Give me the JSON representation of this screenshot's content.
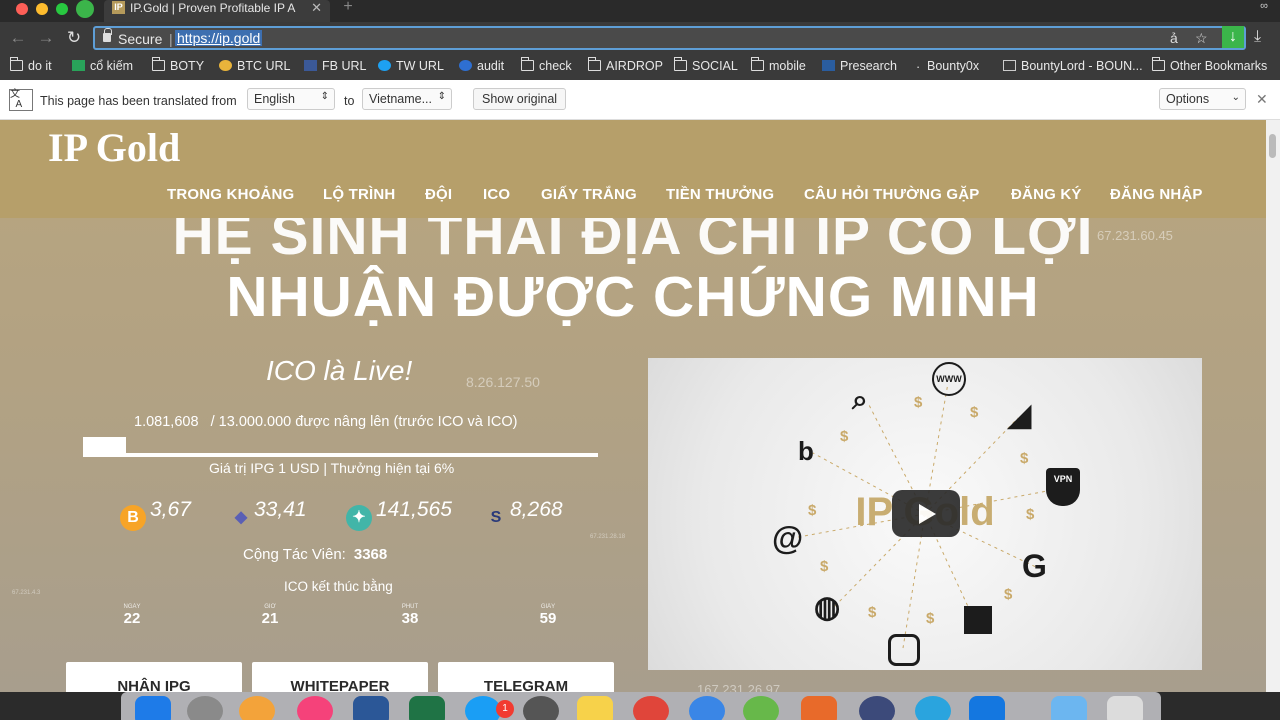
{
  "browser": {
    "tab_title": "IP.Gold | Proven Profitable IP A",
    "tab_favicon": "IP",
    "secure_label": "Secure",
    "separator": "|",
    "url": "https://ip.gold",
    "bookmarks": [
      "do it",
      "cổ kiếm",
      "BOTY",
      "BTC URL",
      "FB URL",
      "TW URL",
      "audit",
      "check",
      "AIRDROP",
      "SOCIAL",
      "mobile",
      "Presearch",
      "Bounty0x",
      "BountyLord - BOUN...",
      "Other Bookmarks"
    ]
  },
  "translate_bar": {
    "message": "This page has been translated from",
    "from_language": "English",
    "to_word": "to",
    "to_language": "Vietname...",
    "show_original": "Show original",
    "options": "Options"
  },
  "site": {
    "logo": "IP Gold",
    "nav": [
      "TRONG KHOẢNG",
      "LỘ TRÌNH",
      "ĐỘI",
      "ICO",
      "GIẤY TRẮNG",
      "TIỀN THƯỞNG",
      "CÂU HỎI THƯỜNG GẶP",
      "ĐĂNG KÝ",
      "ĐĂNG NHẬP"
    ],
    "hero_line1": "HỆ SINH THÁI ĐỊA CHỈ IP CÓ LỢI",
    "hero_line2": "NHUẬN ĐƯỢC CHỨNG MINH",
    "floating_ips": [
      "67.231.60.45",
      "8.26.127.50",
      "67.231.28.18",
      "67.231.4.3",
      "167.231.26.97"
    ]
  },
  "ico": {
    "status": "ICO là Live!",
    "raised": "1.081,608",
    "target_text": "/ 13.000.000 được nâng lên (trước ICO và ICO)",
    "progress_fraction": 0.0832,
    "price_note": "Giá trị IPG 1 USD | Thưởng hiện tại 6%",
    "coins": [
      {
        "icon": "bitcoin-icon",
        "value": "3,67",
        "color": "#f7a427"
      },
      {
        "icon": "ethereum-icon",
        "value": "33,41",
        "color": "#5a5fb5"
      },
      {
        "icon": "nem-icon",
        "value": "141,565",
        "color": "#42b5a8"
      },
      {
        "icon": "waves-icon",
        "value": "8,268",
        "color": "#2a3a7a"
      }
    ],
    "affiliates_label": "Cộng Tác Viên:",
    "affiliates_count": "3368",
    "ends_label": "ICO kết thúc bằng",
    "countdown": [
      {
        "label": "NGÀY",
        "value": "22"
      },
      {
        "label": "GIỜ",
        "value": "21"
      },
      {
        "label": "PHÚT",
        "value": "38"
      },
      {
        "label": "GIÂY",
        "value": "59"
      }
    ],
    "buttons": [
      "NHẬN IPG",
      "WHITEPAPER",
      "TELEGRAM"
    ]
  },
  "video": {
    "title": "IP Gold",
    "icons": [
      "search-icon",
      "www-icon",
      "vpn-icon",
      "google-icon",
      "bing-icon",
      "at-icon",
      "globe-icon",
      "instagram-icon",
      "server-icon",
      "arrow-logo-icon"
    ]
  }
}
